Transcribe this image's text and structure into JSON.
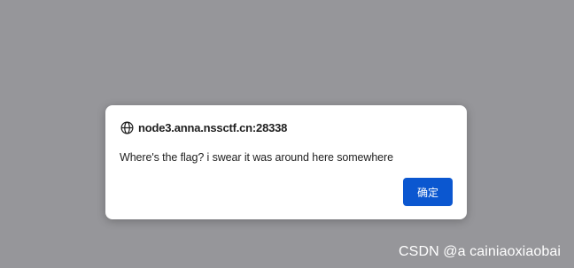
{
  "dialog": {
    "origin": "node3.anna.nssctf.cn:28338",
    "message": "Where's the flag? i swear it was around here somewhere",
    "ok_label": "确定",
    "icon": "globe-icon"
  },
  "watermark": {
    "text": "CSDN @a cainiaoxiaobai"
  },
  "colors": {
    "overlay": "#96969a",
    "dialog_bg": "#ffffff",
    "button_bg": "#0b57d0",
    "button_text": "#ffffff"
  }
}
